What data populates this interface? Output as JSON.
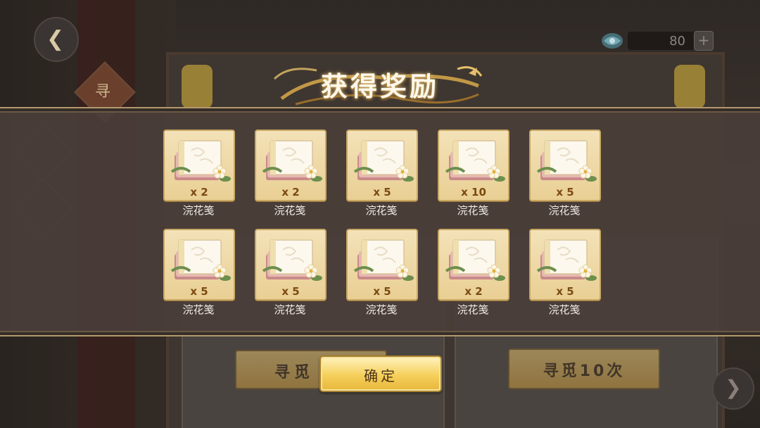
{
  "header": {
    "currency_amount": "80",
    "plus_symbol": "+"
  },
  "popup": {
    "title": "获得奖励",
    "items": [
      {
        "name": "浣花笺",
        "qty": "x 2"
      },
      {
        "name": "浣花笺",
        "qty": "x 2"
      },
      {
        "name": "浣花笺",
        "qty": "x 5"
      },
      {
        "name": "浣花笺",
        "qty": "x 10"
      },
      {
        "name": "浣花笺",
        "qty": "x 5"
      },
      {
        "name": "浣花笺",
        "qty": "x 5"
      },
      {
        "name": "浣花笺",
        "qty": "x 5"
      },
      {
        "name": "浣花笺",
        "qty": "x 5"
      },
      {
        "name": "浣花笺",
        "qty": "x 2"
      },
      {
        "name": "浣花笺",
        "qty": "x 5"
      }
    ],
    "confirm_label": "确定"
  },
  "background": {
    "left_diamond_label": "寻",
    "search_once_label": "寻觅",
    "search_ten_label": "寻觅10次"
  },
  "colors": {
    "band": "#4a3e3a",
    "item_frame": "#efdaa7",
    "confirm_gold": "#f5cf5a",
    "qty_text": "#7a4a10"
  }
}
